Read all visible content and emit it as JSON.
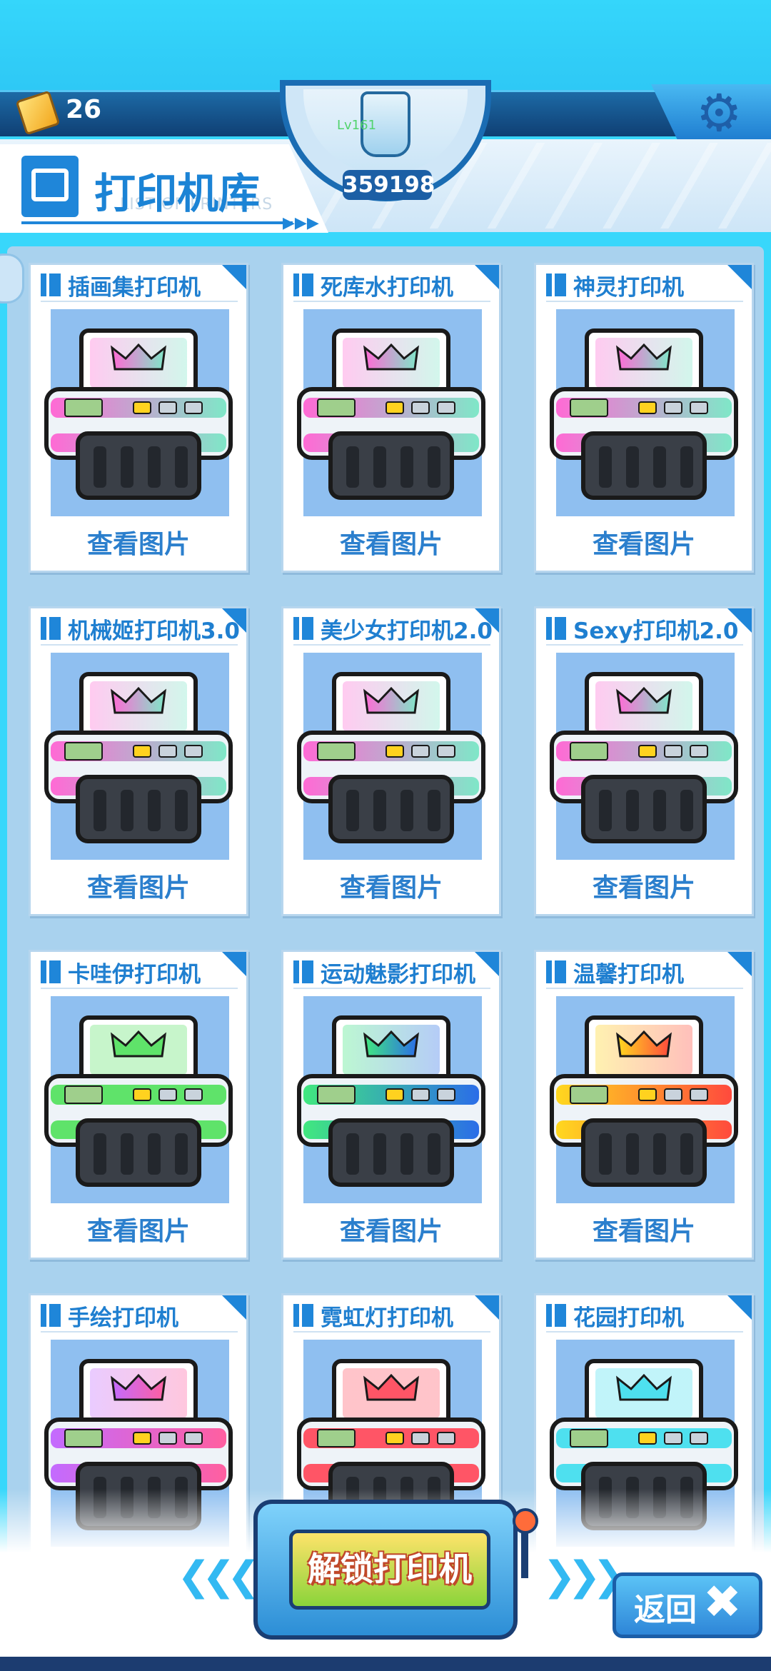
{
  "currency": {
    "value": "26"
  },
  "badge": {
    "value": "359198",
    "tag": "Lv161"
  },
  "header": {
    "title": "打印机库",
    "subtitle": "LIST OF PRINTERS",
    "arrows": "▶▶▶"
  },
  "printers": [
    {
      "name": "插画集打印机",
      "action": "查看图片",
      "colors": [
        "#ff6ad5",
        "#7fe7c8"
      ]
    },
    {
      "name": "死库水打印机",
      "action": "查看图片",
      "colors": [
        "#ff6ad5",
        "#7fe7c8"
      ]
    },
    {
      "name": "神灵打印机",
      "action": "查看图片",
      "colors": [
        "#ff6ad5",
        "#7fe7c8"
      ]
    },
    {
      "name": "机械姬打印机3.0",
      "action": "查看图片",
      "colors": [
        "#ff6ad5",
        "#7fe7c8"
      ]
    },
    {
      "name": "美少女打印机2.0",
      "action": "查看图片",
      "colors": [
        "#ff6ad5",
        "#7fe7c8"
      ]
    },
    {
      "name": "Sexy打印机2.0",
      "action": "查看图片",
      "colors": [
        "#ff6ad5",
        "#7fe7c8"
      ]
    },
    {
      "name": "卡哇伊打印机",
      "action": "查看图片",
      "colors": [
        "#5fe36a",
        "#5fe36a"
      ]
    },
    {
      "name": "运动魅影打印机",
      "action": "查看图片",
      "colors": [
        "#41e87f",
        "#2b6de8"
      ]
    },
    {
      "name": "温馨打印机",
      "action": "查看图片",
      "colors": [
        "#ffd81f",
        "#ff4a3d"
      ]
    },
    {
      "name": "手绘打印机",
      "action": "",
      "colors": [
        "#c36bff",
        "#ff5fa0"
      ]
    },
    {
      "name": "霓虹灯打印机",
      "action": "",
      "colors": [
        "#ff5566",
        "#ff5566"
      ]
    },
    {
      "name": "花园打印机",
      "action": "",
      "colors": [
        "#4ee0ef",
        "#4ee0ef"
      ]
    }
  ],
  "unlock": {
    "label": "解锁打印机"
  },
  "back": {
    "label": "返回"
  },
  "icons": {
    "currency": "ticket-icon",
    "badge": "bottle-icon",
    "settings": "gear-icon",
    "title": "printer-icon",
    "back": "close-icon"
  }
}
